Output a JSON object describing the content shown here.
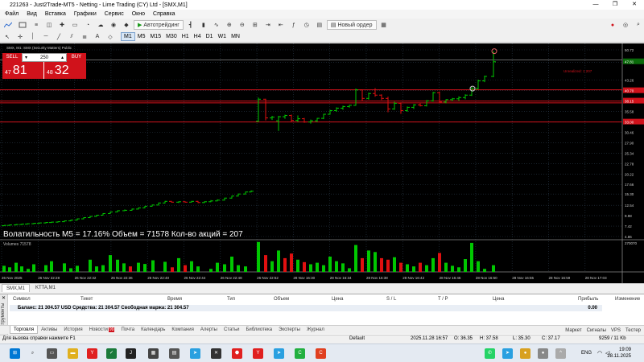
{
  "window": {
    "title": "221263 - Just2Trade-MT5 - Netting - Lime Trading (CY) Ltd - [SMX,M1]",
    "controls": [
      "—",
      "❐",
      "✕"
    ]
  },
  "menu": {
    "items": [
      "Файл",
      "Вид",
      "Вставка",
      "Графики",
      "Сервис",
      "Окно",
      "Справка"
    ]
  },
  "toolbar": {
    "autotrade_label": "Автотрейдинг",
    "new_order_label": "Новый ордер",
    "timeframes": [
      "M1",
      "M5",
      "M15",
      "M30",
      "H1",
      "H4",
      "D1",
      "W1",
      "MN"
    ],
    "active_timeframe": "M1"
  },
  "chart": {
    "header": "SMX, M1:  SMX (Security Matters) Public",
    "trade_panel": {
      "sell_label": "SELL",
      "buy_label": "BUY",
      "lot": "250",
      "sell_price_small": "47",
      "sell_price_big": "81",
      "buy_price_small": "48",
      "buy_price_big": "32"
    },
    "overlay_text": "Волатильность M5 = 17.16% Объем = 71578 Кол-во акций = 207",
    "volume_label": "Volumes 71578",
    "right_label": "Unrealized: 1 207",
    "price_axis": [
      "50.72",
      "47.61",
      "43.26",
      "40.70",
      "38.15",
      "35.58",
      "33.02",
      "30.46",
      "27.90",
      "25.34",
      "22.78",
      "20.22",
      "17.66",
      "15.30",
      "12.54",
      "9.98",
      "7.42",
      "4.86"
    ],
    "price_tags": {
      "current": "47.81",
      "line1": "40.70",
      "line2": "38.15",
      "line3": "33.00"
    },
    "volume_axis": "270070",
    "time_axis": [
      "26 Nov 2025",
      "26 Nov 22:28",
      "26 Nov 22:32",
      "26 Nov 22:36",
      "26 Nov 22:40",
      "26 Nov 22:44",
      "26 Nov 22:48",
      "26 Nov 22:52",
      "28 Nov 16:30",
      "28 Nov 16:34",
      "28 Nov 16:38",
      "28 Nov 16:42",
      "28 Nov 16:46",
      "28 Nov 16:50",
      "28 Nov 16:55",
      "28 Nov 16:59",
      "28 Nov 17:03"
    ],
    "colors": {
      "bull": "#00c800",
      "bear": "#e01010",
      "hline": "#d0121b",
      "grid": "#2a3a4a"
    }
  },
  "chart_tabs": [
    "SMX,M1",
    "KTTA,M1"
  ],
  "toolbox": {
    "vertical_label": "Инструменты",
    "columns": [
      "Символ",
      "Тикет",
      "Время",
      "Тип",
      "Объем",
      "Цена",
      "S / L",
      "T / P",
      "Цена",
      "Прибыль",
      "Изменение"
    ],
    "balance_line": "Баланс: 21 304.57 USD  Средства: 21 304.57  Свободная маржа: 21 304.57",
    "profit": "0.00"
  },
  "bottom_tabs": [
    "Торговля",
    "Активы",
    "История",
    "Новости",
    "Почта",
    "Календарь",
    "Компания",
    "Алерты",
    "Статьи",
    "Библиотека",
    "Эксперты",
    "Журнал"
  ],
  "news_badge": "99",
  "right_links": [
    "Маркет",
    "Сигналы",
    "VPS",
    "Тестер"
  ],
  "status": {
    "help": "Для вызова справки нажмите F1",
    "profile": "Default",
    "datetime": "2025.11.28 16:57",
    "open": "O: 36.35",
    "high": "H: 37.58",
    "low": "L: 35.30",
    "close": "C: 37.17",
    "traffic": "9259 / 11 Kb"
  },
  "taskbar": {
    "lang": "ENG",
    "time": "19:09",
    "date": "28.11.2025"
  }
}
